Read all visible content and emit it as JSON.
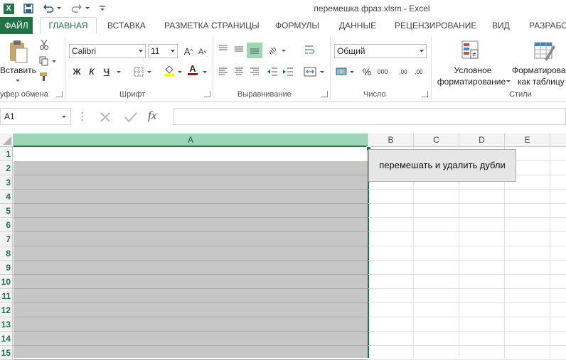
{
  "window": {
    "title": "перемешка фраз.xlsm - Excel"
  },
  "quick_access": {
    "icons": [
      "excel-logo-icon",
      "save-icon",
      "undo-icon",
      "redo-icon",
      "customize-icon"
    ],
    "excel_letter": "X"
  },
  "tabs": [
    {
      "label": "ФАЙЛ"
    },
    {
      "label": "ГЛАВНАЯ"
    },
    {
      "label": "ВСТАВКА"
    },
    {
      "label": "РАЗМЕТКА СТРАНИЦЫ"
    },
    {
      "label": "ФОРМУЛЫ"
    },
    {
      "label": "ДАННЫЕ"
    },
    {
      "label": "РЕЦЕНЗИРОВАНИЕ"
    },
    {
      "label": "ВИД"
    },
    {
      "label": "РАЗРАБО"
    }
  ],
  "ribbon": {
    "clipboard": {
      "paste_label": "Вставить",
      "group_label": "уфер обмена"
    },
    "font": {
      "font_name": "Calibri",
      "font_size": "11",
      "bold": "Ж",
      "italic": "К",
      "underline": "Ч",
      "grow": "A",
      "shrink": "A",
      "color_letter": "A",
      "group_label": "Шрифт",
      "fill_color": "#ffff00",
      "font_color": "#c00000"
    },
    "alignment": {
      "group_label": "Выравнивание"
    },
    "number": {
      "format": "Общий",
      "percent": "%",
      "thousands": "000",
      "inc_decimal": ",00",
      "dec_decimal": ",00",
      "group_label": "Число"
    },
    "styles": {
      "conditional_line1": "Условное",
      "conditional_line2": "форматирование",
      "format_table_line1": "Форматирова",
      "format_table_line2": "как таблицу",
      "group_label": "Стили"
    }
  },
  "formula_bar": {
    "name_box": "A1",
    "fx": "fx",
    "content": ""
  },
  "grid": {
    "columns": [
      "A",
      "B",
      "C",
      "D",
      "E"
    ],
    "rows": [
      "1",
      "2",
      "3",
      "4",
      "5",
      "6",
      "7",
      "8",
      "9",
      "10",
      "11",
      "12",
      "13",
      "14",
      "15"
    ],
    "selected_column": "A"
  },
  "macro_button": {
    "label": "перемешать и удалить дубли"
  },
  "colors": {
    "accent": "#217346",
    "selection_header": "#9fd5b7",
    "selection_fill": "#c6c6c6"
  }
}
